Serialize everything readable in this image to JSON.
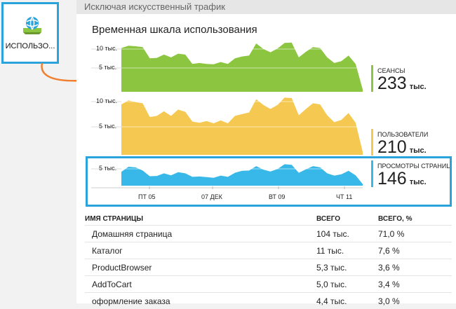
{
  "tile": {
    "label": "ИСПОЛЬЗО..."
  },
  "panel": {
    "header": "Исключая искусственный трафик",
    "chart_title": "Временная шкала использования"
  },
  "chart_data": {
    "type": "area",
    "title": "Временная шкала использования",
    "x_ticks": [
      "ПТ 05",
      "07 ДЕК",
      "ВТ 09",
      "ЧТ 11"
    ],
    "series": [
      {
        "name": "СЕАНСЫ",
        "color": "#8cc641",
        "y_ticks": [
          "10 тыс.",
          "5 тыс."
        ],
        "ylim": [
          0,
          11000
        ],
        "values": [
          9400,
          9900,
          9800,
          9600,
          7200,
          7300,
          8000,
          7400,
          8200,
          8000,
          6000,
          6200,
          6000,
          5900,
          6400,
          6000,
          7200,
          7600,
          7800,
          10400,
          9200,
          8500,
          9300,
          10500,
          10600,
          7400,
          8600,
          9600,
          9400,
          7400,
          6200,
          6600,
          7800,
          6000,
          500
        ]
      },
      {
        "name": "ПОЛЬЗОВАТЕЛИ",
        "color": "#f5c951",
        "y_ticks": [
          "10 тыс.",
          "5 тыс."
        ],
        "ylim": [
          0,
          11000
        ],
        "values": [
          8800,
          9500,
          9200,
          9000,
          6600,
          6800,
          7600,
          6800,
          7900,
          7500,
          5800,
          5600,
          5900,
          5500,
          6000,
          5500,
          6800,
          7100,
          7400,
          9700,
          8700,
          8000,
          8700,
          10000,
          9900,
          6900,
          8000,
          9000,
          8800,
          6900,
          5700,
          6100,
          7300,
          5600,
          500
        ]
      },
      {
        "name": "ПРОСМОТРЫ СТРАНИЦ",
        "color": "#37b8e8",
        "y_ticks": [
          "5 тыс."
        ],
        "ylim": [
          0,
          8000
        ],
        "values": [
          4400,
          6000,
          5800,
          4800,
          3000,
          3100,
          3900,
          3300,
          4300,
          3900,
          2800,
          2900,
          2700,
          2500,
          3200,
          2800,
          4100,
          4700,
          4800,
          6200,
          5100,
          4500,
          5300,
          6800,
          6600,
          4100,
          5200,
          6200,
          5800,
          3900,
          3200,
          3600,
          4700,
          3300,
          500
        ]
      }
    ]
  },
  "metrics": [
    {
      "name": "СЕАНСЫ",
      "value": "233",
      "unit": "тыс.",
      "color": "#8cc641"
    },
    {
      "name": "ПОЛЬЗОВАТЕЛИ",
      "value": "210",
      "unit": "тыс.",
      "color": "#f5c951"
    },
    {
      "name": "ПРОСМОТРЫ СТРАНИЦ",
      "value": "146",
      "unit": "тыс.",
      "color": "#37b8e8"
    }
  ],
  "table": {
    "headers": [
      "ИМЯ СТРАНИЦЫ",
      "ВСЕГО",
      "ВСЕГО, %"
    ],
    "rows": [
      [
        "Домашняя страница",
        "104 тыс.",
        "71,0 %"
      ],
      [
        "Каталог",
        "11 тыс.",
        "7,6 %"
      ],
      [
        "ProductBrowser",
        "5,3 тыс.",
        "3,6 %"
      ],
      [
        "AddToCart",
        "5,0 тыс.",
        "3,4 %"
      ],
      [
        "оформление заказа",
        "4,4 тыс.",
        "3,0 %"
      ]
    ]
  }
}
